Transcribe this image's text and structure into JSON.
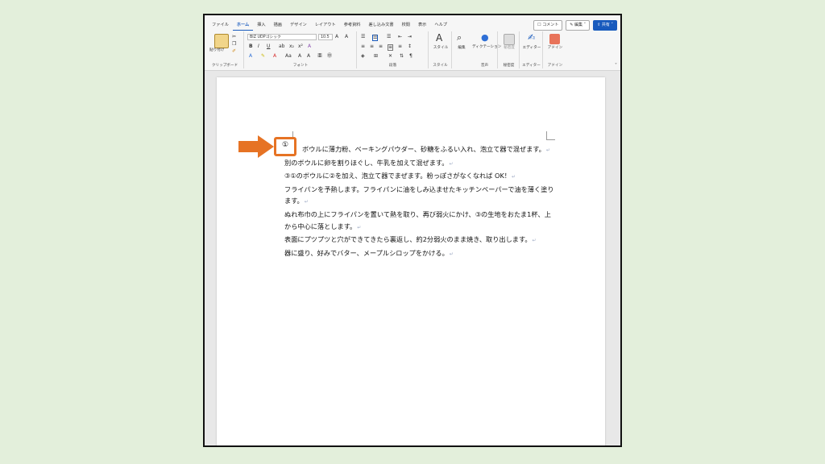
{
  "tabs": [
    "ファイル",
    "ホーム",
    "挿入",
    "描画",
    "デザイン",
    "レイアウト",
    "参考資料",
    "差し込み文書",
    "校閲",
    "表示",
    "ヘルプ"
  ],
  "active_tab": "ホーム",
  "top_buttons": {
    "comment": "コメント",
    "edit": "編集",
    "share": "共有"
  },
  "ribbon": {
    "clipboard": {
      "paste_label": "貼り付け",
      "group_label": "クリップボード"
    },
    "font": {
      "font_name": "BIZ UDPゴシック",
      "font_size": "10.5",
      "group_label": "フォント"
    },
    "paragraph": {
      "group_label": "段落"
    },
    "styles": {
      "label": "スタイル",
      "group_label": "スタイル"
    },
    "editing": {
      "label": "編集"
    },
    "voice": {
      "label": "ディクテーション",
      "group_label": "音声"
    },
    "sensitivity": {
      "label": "秘密度",
      "group_label": "秘密度"
    },
    "editor": {
      "label": "エディター",
      "group_label": "エディター"
    },
    "addins": {
      "label": "アドイン",
      "group_label": "アドイン"
    }
  },
  "highlight_marker": "①",
  "document_lines": [
    "ボウルに薄力粉、ベーキングパウダー、砂糖をふるい入れ、泡立て器で混ぜます。",
    "別のボウルに卵を割りほぐし、牛乳を加えて混ぜます。",
    "③①のボウルに②を加え、泡立て器でまぜます。粉っぽさがなくなれば OK！",
    "フライパンを予熱します。フライパンに油をしみ込ませたキッチンペーパーで油を薄く塗り",
    "ます。",
    "ぬれ布巾の上にフライパンを置いて熱を取り、再び弱火にかけ、③の生地をおたま1杯、上",
    "から中心に落とします。",
    "表面にプツプツと穴ができてきたら裏返し、約2分弱火のまま焼き、取り出します。",
    "器に盛り、好みでバター、メープルシロップをかける。"
  ],
  "colors": {
    "accent": "#185abd",
    "arrow": "#e67324",
    "background": "#e3efdb"
  }
}
